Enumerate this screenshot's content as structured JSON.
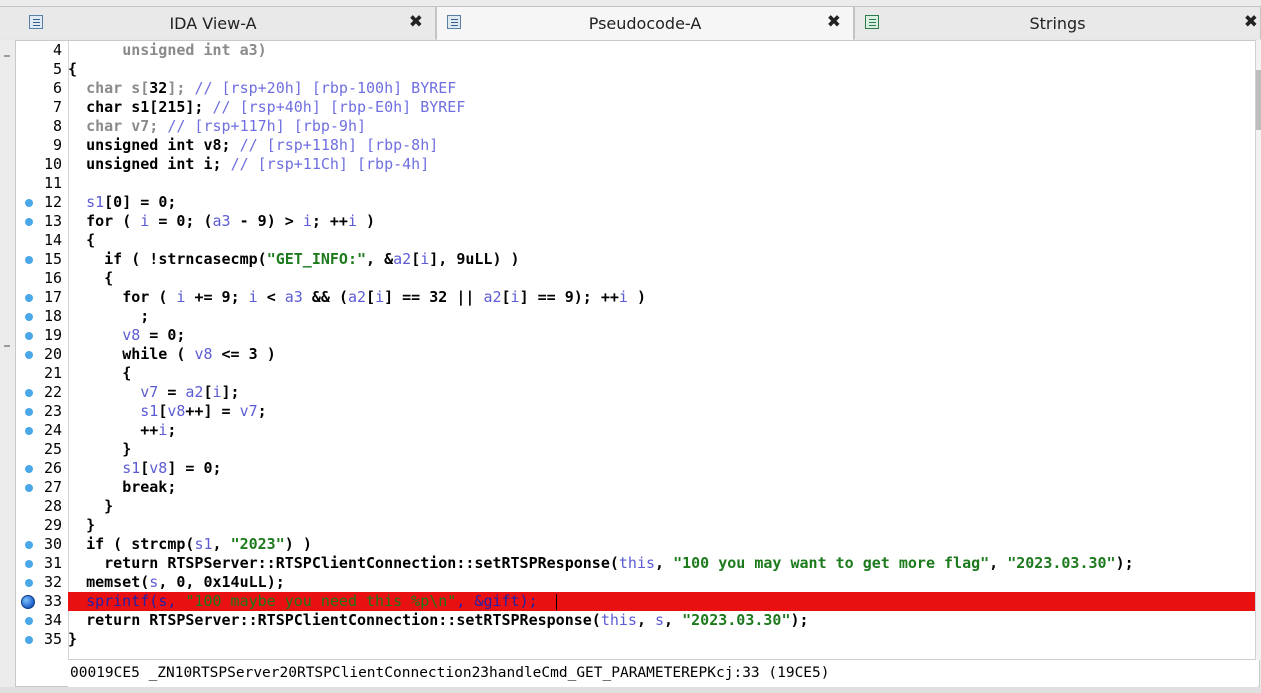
{
  "tabs": [
    {
      "label": "IDA View-A",
      "close": "✖",
      "icon": "disassembly-view-icon",
      "active": false
    },
    {
      "label": "Pseudocode-A",
      "close": "✖",
      "icon": "pseudocode-view-icon",
      "active": true
    },
    {
      "label": "Strings",
      "close": "✖",
      "icon": "strings-view-icon",
      "active": false
    }
  ],
  "lines": [
    {
      "n": "4",
      "bp": "none",
      "text": "      unsigned int a3)"
    },
    {
      "n": "5",
      "bp": "none",
      "text": "{"
    },
    {
      "n": "6",
      "bp": "none",
      "text": "  char s[32]; // [rsp+20h] [rbp-100h] BYREF"
    },
    {
      "n": "7",
      "bp": "none",
      "text": "  char s1[215]; // [rsp+40h] [rbp-E0h] BYREF"
    },
    {
      "n": "8",
      "bp": "none",
      "text": "  char v7; // [rsp+117h] [rbp-9h]"
    },
    {
      "n": "9",
      "bp": "none",
      "text": "  unsigned int v8; // [rsp+118h] [rbp-8h]"
    },
    {
      "n": "10",
      "bp": "none",
      "text": "  unsigned int i; // [rsp+11Ch] [rbp-4h]"
    },
    {
      "n": "11",
      "bp": "none",
      "text": ""
    },
    {
      "n": "12",
      "bp": "dot",
      "text": "  s1[0] = 0;"
    },
    {
      "n": "13",
      "bp": "dot",
      "text": "  for ( i = 0; (a3 - 9) > i; ++i )"
    },
    {
      "n": "14",
      "bp": "none",
      "text": "  {"
    },
    {
      "n": "15",
      "bp": "dot",
      "text": "    if ( !strncasecmp(\"GET_INFO:\", &a2[i], 9uLL) )"
    },
    {
      "n": "16",
      "bp": "none",
      "text": "    {"
    },
    {
      "n": "17",
      "bp": "dot",
      "text": "      for ( i += 9; i < a3 && (a2[i] == 32 || a2[i] == 9); ++i )"
    },
    {
      "n": "18",
      "bp": "dot",
      "text": "        ;"
    },
    {
      "n": "19",
      "bp": "dot",
      "text": "      v8 = 0;"
    },
    {
      "n": "20",
      "bp": "dot",
      "text": "      while ( v8 <= 3 )"
    },
    {
      "n": "21",
      "bp": "none",
      "text": "      {"
    },
    {
      "n": "22",
      "bp": "dot",
      "text": "        v7 = a2[i];"
    },
    {
      "n": "23",
      "bp": "dot",
      "text": "        s1[v8++] = v7;"
    },
    {
      "n": "24",
      "bp": "dot",
      "text": "        ++i;"
    },
    {
      "n": "25",
      "bp": "none",
      "text": "      }"
    },
    {
      "n": "26",
      "bp": "dot",
      "text": "      s1[v8] = 0;"
    },
    {
      "n": "27",
      "bp": "dot",
      "text": "      break;"
    },
    {
      "n": "28",
      "bp": "none",
      "text": "    }"
    },
    {
      "n": "29",
      "bp": "none",
      "text": "  }"
    },
    {
      "n": "30",
      "bp": "dot",
      "text": "  if ( strcmp(s1, \"2023\") )"
    },
    {
      "n": "31",
      "bp": "dot",
      "text": "    return RTSPServer::RTSPClientConnection::setRTSPResponse(this, \"100 you may want to get more flag\", \"2023.03.30\");"
    },
    {
      "n": "32",
      "bp": "dot",
      "text": "  memset(s, 0, 0x14uLL);"
    },
    {
      "n": "33",
      "bp": "breakpoint",
      "text": "  sprintf(s, \"100 maybe you need this %p\\n\", &gift);"
    },
    {
      "n": "34",
      "bp": "dot",
      "text": "  return RTSPServer::RTSPClientConnection::setRTSPResponse(this, s, \"2023.03.30\");"
    },
    {
      "n": "35",
      "bp": "dot",
      "text": "}"
    }
  ],
  "highlighted_line": "33",
  "status_text": "00019CE5 _ZN10RTSPServer20RTSPClientConnection23handleCmd_GET_PARAMETEREPKcj:33 (19CE5)",
  "colors": {
    "highlight": "#e81010",
    "variable": "#5c5cd4",
    "comment": "#6f6fe0",
    "string": "#1d7a1d",
    "gutter_dot": "#4aa8e8"
  }
}
